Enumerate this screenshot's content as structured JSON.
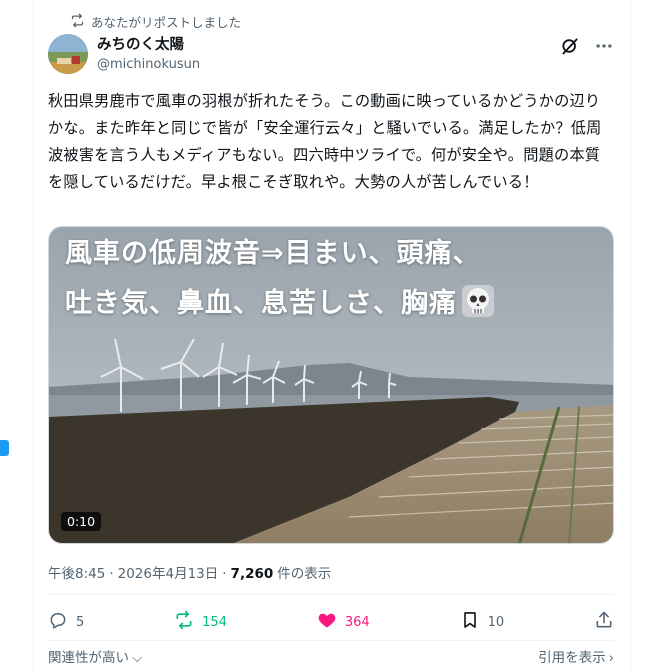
{
  "repost": {
    "label": "あなたがリポストしました"
  },
  "author": {
    "name": "みちのく太陽",
    "handle": "@michinokusun"
  },
  "tweet": {
    "text": "秋田県男鹿市で風車の羽根が折れたそう。この動画に映っているかどうかの辺りかな。また昨年と同じで皆が「安全運行云々」と騒いでいる。満足したか？低周波被害を言う人もメディアもない。四六時中ツライで。何が安全や。問題の本質を隠しているだけだ。早よ根こそぎ取れや。大勢の人が苦しんでいる！"
  },
  "media": {
    "overlay_line1": "風車の低周波音⇒目まい、頭痛、",
    "overlay_line2": "吐き気、鼻血、息苦しさ、胸痛",
    "duration": "0:10",
    "overlay_icon": "skull-icon"
  },
  "meta": {
    "time": "午後8:45",
    "separator": "·",
    "date": "2026年4月13日",
    "views": "7,260",
    "views_label": "件の表示"
  },
  "actions": {
    "replies": "5",
    "reposts": "154",
    "likes": "364",
    "bookmarks": "10"
  },
  "footer": {
    "relevance": "関連性が高い",
    "quotes": "引用を表示"
  },
  "colors": {
    "retweet": "#00ba7c",
    "like": "#f91880",
    "accent": "#1d9bf0",
    "secondary_text": "#536471"
  }
}
